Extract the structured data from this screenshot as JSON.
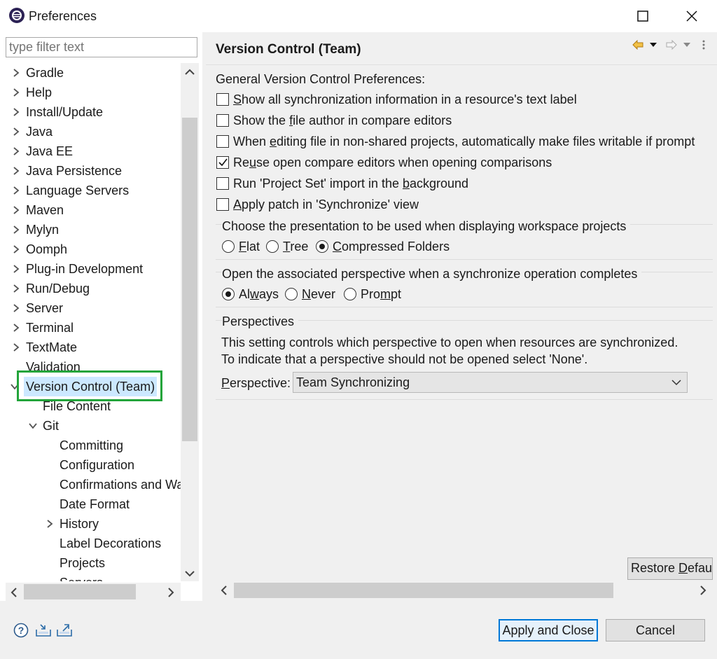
{
  "window": {
    "title": "Preferences"
  },
  "filter": {
    "placeholder": "type filter text"
  },
  "tree": {
    "items": [
      {
        "label": "Gradle",
        "expandable": true,
        "expanded": false,
        "level": 0
      },
      {
        "label": "Help",
        "expandable": true,
        "expanded": false,
        "level": 0
      },
      {
        "label": "Install/Update",
        "expandable": true,
        "expanded": false,
        "level": 0
      },
      {
        "label": "Java",
        "expandable": true,
        "expanded": false,
        "level": 0
      },
      {
        "label": "Java EE",
        "expandable": true,
        "expanded": false,
        "level": 0
      },
      {
        "label": "Java Persistence",
        "expandable": true,
        "expanded": false,
        "level": 0
      },
      {
        "label": "Language Servers",
        "expandable": true,
        "expanded": false,
        "level": 0
      },
      {
        "label": "Maven",
        "expandable": true,
        "expanded": false,
        "level": 0
      },
      {
        "label": "Mylyn",
        "expandable": true,
        "expanded": false,
        "level": 0
      },
      {
        "label": "Oomph",
        "expandable": true,
        "expanded": false,
        "level": 0
      },
      {
        "label": "Plug-in Development",
        "expandable": true,
        "expanded": false,
        "level": 0
      },
      {
        "label": "Run/Debug",
        "expandable": true,
        "expanded": false,
        "level": 0
      },
      {
        "label": "Server",
        "expandable": true,
        "expanded": false,
        "level": 0
      },
      {
        "label": "Terminal",
        "expandable": true,
        "expanded": false,
        "level": 0
      },
      {
        "label": "TextMate",
        "expandable": true,
        "expanded": false,
        "level": 0
      },
      {
        "label": "Validation",
        "expandable": false,
        "expanded": false,
        "level": 0
      },
      {
        "label": "Version Control (Team)",
        "expandable": true,
        "expanded": true,
        "level": 0,
        "selected": true
      },
      {
        "label": "File Content",
        "expandable": false,
        "expanded": false,
        "level": 1
      },
      {
        "label": "Git",
        "expandable": true,
        "expanded": true,
        "level": 1
      },
      {
        "label": "Committing",
        "expandable": false,
        "expanded": false,
        "level": 2
      },
      {
        "label": "Configuration",
        "expandable": false,
        "expanded": false,
        "level": 2
      },
      {
        "label": "Confirmations and Wa",
        "expandable": false,
        "expanded": false,
        "level": 2
      },
      {
        "label": "Date Format",
        "expandable": false,
        "expanded": false,
        "level": 2
      },
      {
        "label": "History",
        "expandable": true,
        "expanded": false,
        "level": 2
      },
      {
        "label": "Label Decorations",
        "expandable": false,
        "expanded": false,
        "level": 2
      },
      {
        "label": "Projects",
        "expandable": false,
        "expanded": false,
        "level": 2
      },
      {
        "label": "Servers",
        "expandable": false,
        "expanded": false,
        "level": 2
      }
    ]
  },
  "page": {
    "title": "Version Control (Team)",
    "general_heading": "General Version Control Preferences:",
    "options": [
      {
        "pre": "",
        "ul": "S",
        "post": "how all synchronization information in a resource's text label",
        "checked": false
      },
      {
        "pre": "Show the ",
        "ul": "f",
        "post": "ile author in compare editors",
        "checked": false
      },
      {
        "pre": "When ",
        "ul": "e",
        "post": "diting file in non-shared projects, automatically make files writable if prompt",
        "checked": false
      },
      {
        "pre": "Re",
        "ul": "u",
        "post": "se open compare editors when opening comparisons",
        "checked": true
      },
      {
        "pre": "Run 'Project Set' import in the ",
        "ul": "b",
        "post": "ackground",
        "checked": false
      },
      {
        "pre": "",
        "ul": "A",
        "post": "pply patch in 'Synchronize' view",
        "checked": false
      }
    ],
    "presentation": {
      "heading": "Choose the presentation to be used when displaying workspace projects",
      "choices": [
        {
          "pre": "",
          "ul": "F",
          "post": "lat",
          "selected": false
        },
        {
          "pre": "",
          "ul": "T",
          "post": "ree",
          "selected": false
        },
        {
          "pre": "",
          "ul": "C",
          "post": "ompressed Folders",
          "selected": true
        }
      ]
    },
    "perspective_open": {
      "heading": "Open the associated perspective when a synchronize operation completes",
      "choices": [
        {
          "pre": "Al",
          "ul": "w",
          "post": "ays",
          "selected": true
        },
        {
          "pre": "",
          "ul": "N",
          "post": "ever",
          "selected": false
        },
        {
          "pre": "Pro",
          "ul": "m",
          "post": "pt",
          "selected": false
        }
      ]
    },
    "perspectives": {
      "heading": "Perspectives",
      "desc1": "This setting controls which perspective to open when resources are synchronized.",
      "desc2": "To indicate that a perspective should not be opened select 'None'.",
      "label_ul": "P",
      "label_rest": "erspective:",
      "value": "Team Synchronizing"
    },
    "restore_pre": "Restore ",
    "restore_ul": "D",
    "restore_post": "efau"
  },
  "buttons": {
    "apply_close": "Apply and Close",
    "cancel": "Cancel"
  },
  "colors": {
    "highlight": "#22a43a",
    "accent": "#0078d7",
    "nav_back": "#e8a317"
  }
}
